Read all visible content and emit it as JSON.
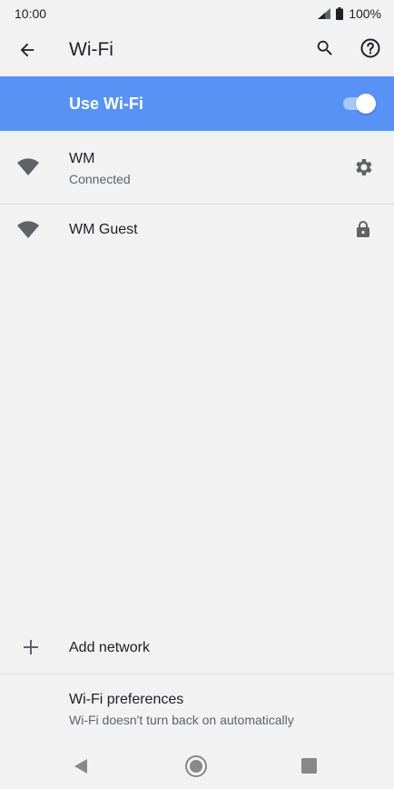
{
  "status_bar": {
    "time": "10:00",
    "battery": "100%"
  },
  "app_bar": {
    "title": "Wi-Fi"
  },
  "master_switch": {
    "label": "Use Wi-Fi",
    "on": true
  },
  "networks": [
    {
      "name": "WM",
      "status": "Connected",
      "trailing_icon": "gear-icon"
    },
    {
      "name": "WM Guest",
      "status": "",
      "trailing_icon": "lock-icon"
    }
  ],
  "add_network": {
    "label": "Add network"
  },
  "preferences": {
    "title": "Wi-Fi preferences",
    "subtitle": "Wi-Fi doesn't turn back on automatically"
  },
  "colors": {
    "accent": "#5892f5",
    "background": "#f2f2f2"
  }
}
